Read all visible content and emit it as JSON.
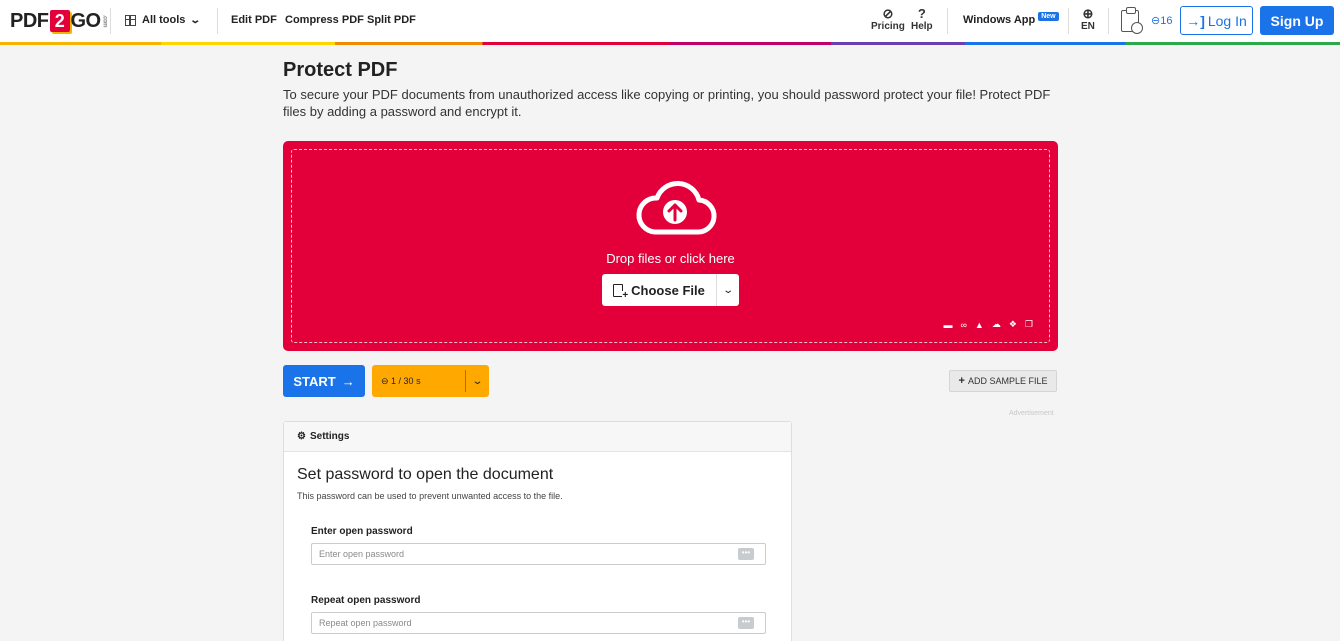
{
  "header": {
    "logo": {
      "pre": "PDF",
      "num": "2",
      "post": "GO",
      "suffix": ".com"
    },
    "all_tools": "All tools",
    "nav": [
      "Edit PDF",
      "Compress PDF",
      "Split PDF"
    ],
    "pricing": "Pricing",
    "help": "Help",
    "windows_app": "Windows App",
    "new_badge": "New",
    "language": "EN",
    "credits": "16",
    "login": "Log In",
    "signup": "Sign Up"
  },
  "page": {
    "title": "Protect PDF",
    "description": "To secure your PDF documents from unauthorized access like copying or printing, you should password protect your file! Protect PDF files by adding a password and encrypt it."
  },
  "upload": {
    "drop_text": "Drop files or click here",
    "choose_file": "Choose File",
    "sources": [
      "folder-icon",
      "link-icon",
      "google-drive-icon",
      "onedrive-icon",
      "dropbox-icon",
      "clipboard-icon"
    ]
  },
  "actions": {
    "start": "START",
    "limits": "1 / 30 s",
    "add_sample": "ADD SAMPLE FILE",
    "advertisement": "Advertisement"
  },
  "settings": {
    "header": "Settings",
    "section_title": "Set password to open the document",
    "section_desc": "This password can be used to prevent unwanted access to the file.",
    "open_password_label": "Enter open password",
    "open_password_placeholder": "Enter open password",
    "repeat_password_label": "Repeat open password",
    "repeat_password_placeholder": "Repeat open password"
  },
  "colors": {
    "accent": "#1a73e8",
    "dropzone": "#e3003a",
    "limits": "#ffa900"
  }
}
